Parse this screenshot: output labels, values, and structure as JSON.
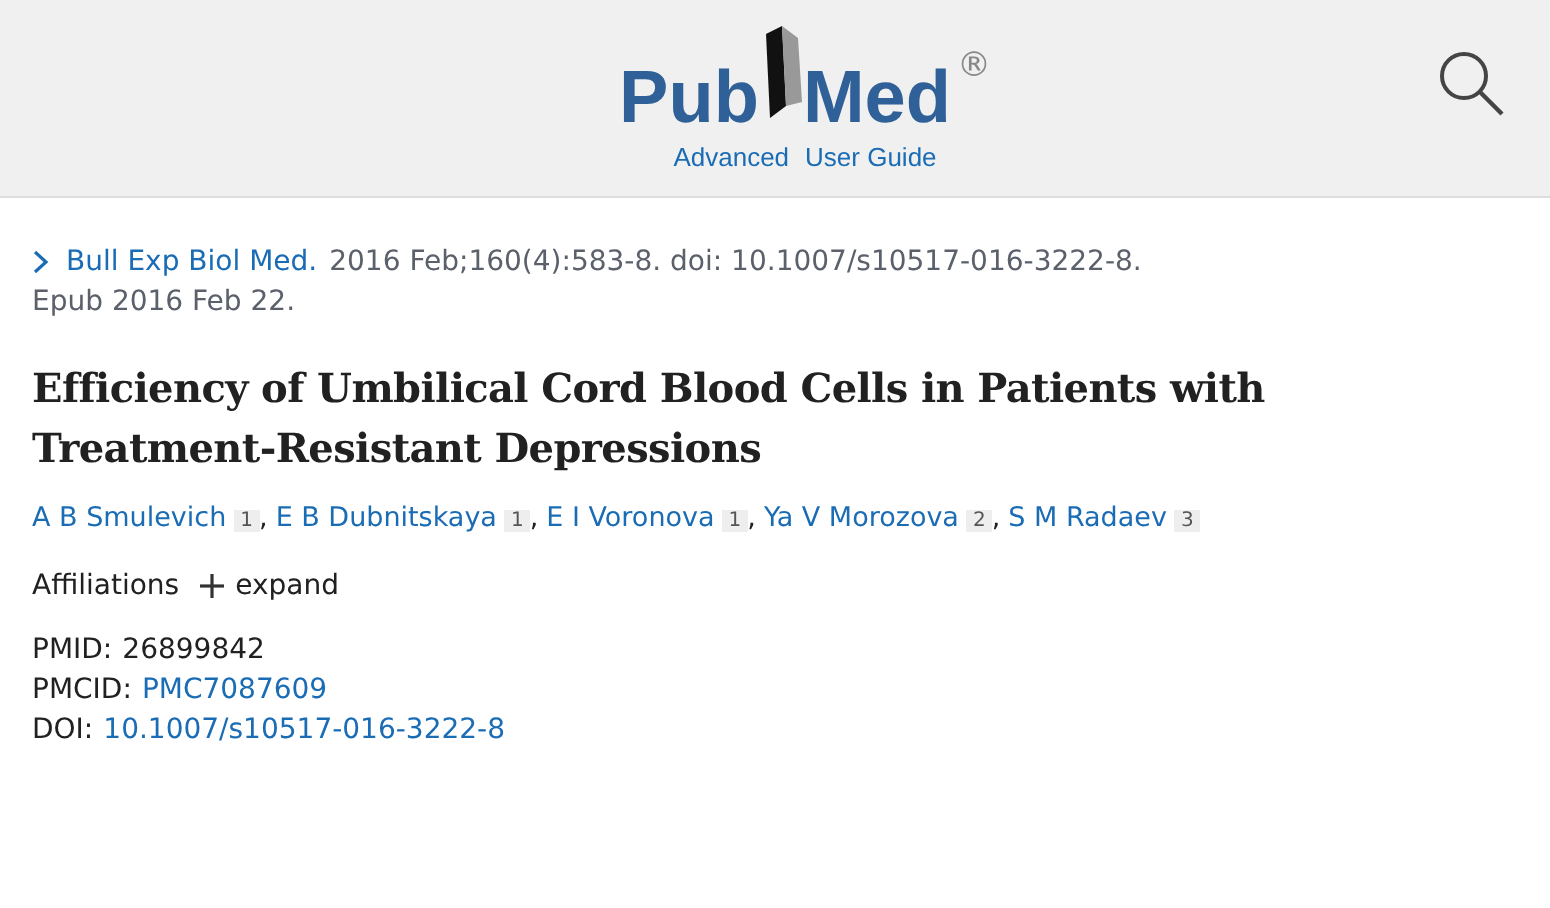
{
  "header": {
    "logo": {
      "left": "Pub",
      "right": "Med",
      "mark": "®"
    },
    "links": [
      "Advanced",
      "User Guide"
    ]
  },
  "citation": {
    "journal": "Bull Exp Biol Med.",
    "details": "2016 Feb;160(4):583-8. doi: 10.1007/s10517-016-3222-8.",
    "epub": "Epub 2016 Feb 22."
  },
  "title": "Efficiency of Umbilical Cord Blood Cells in Patients with Treatment-Resistant Depressions",
  "authors": [
    {
      "name": "A B Smulevich",
      "affiliation": "1",
      "separator": ","
    },
    {
      "name": "E B Dubnitskaya",
      "affiliation": "1",
      "separator": ","
    },
    {
      "name": "E I Voronova",
      "affiliation": "1",
      "separator": ","
    },
    {
      "name": "Ya V Morozova",
      "affiliation": "2",
      "separator": ","
    },
    {
      "name": "S M Radaev",
      "affiliation": "3"
    }
  ],
  "affiliations": {
    "label": "Affiliations",
    "toggle": "expand",
    "expanded": false
  },
  "identifiers": [
    {
      "label": "PMID:",
      "value": "26899842",
      "link": false
    },
    {
      "label": "PMCID:",
      "value": "PMC7087609",
      "link": true
    },
    {
      "label": "DOI:",
      "value": "10.1007/s10517-016-3222-8",
      "link": true
    }
  ]
}
